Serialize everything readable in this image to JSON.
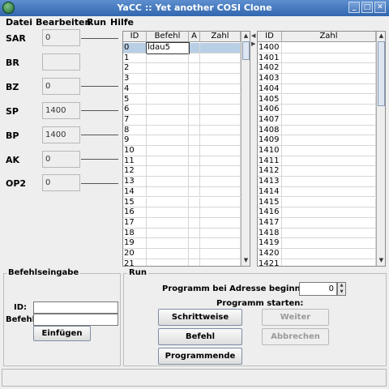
{
  "window": {
    "title": "YaCC :: Yet another COSI Clone",
    "buttons": [
      "_",
      "□",
      "✕"
    ],
    "icon": "globe-icon"
  },
  "menu": [
    "Datei",
    "Bearbeiten",
    "Run",
    "Hilfe"
  ],
  "registers": [
    {
      "label": "SAR",
      "value": "0"
    },
    {
      "label": "BR",
      "value": ""
    },
    {
      "label": "BZ",
      "value": "0"
    },
    {
      "label": "SP",
      "value": "1400"
    },
    {
      "label": "BP",
      "value": "1400"
    },
    {
      "label": "AK",
      "value": "0"
    },
    {
      "label": "OP2",
      "value": "0"
    }
  ],
  "program_table": {
    "headers": [
      "ID",
      "Befehl",
      "A",
      "Zahl"
    ],
    "rows": [
      [
        "0",
        "ldau5",
        "",
        ""
      ],
      [
        "1",
        "",
        "",
        ""
      ],
      [
        "2",
        "",
        "",
        ""
      ],
      [
        "3",
        "",
        "",
        ""
      ],
      [
        "4",
        "",
        "",
        ""
      ],
      [
        "5",
        "",
        "",
        ""
      ],
      [
        "6",
        "",
        "",
        ""
      ],
      [
        "7",
        "",
        "",
        ""
      ],
      [
        "8",
        "",
        "",
        ""
      ],
      [
        "9",
        "",
        "",
        ""
      ],
      [
        "10",
        "",
        "",
        ""
      ],
      [
        "11",
        "",
        "",
        ""
      ],
      [
        "12",
        "",
        "",
        ""
      ],
      [
        "13",
        "",
        "",
        ""
      ],
      [
        "14",
        "",
        "",
        ""
      ],
      [
        "15",
        "",
        "",
        ""
      ],
      [
        "16",
        "",
        "",
        ""
      ],
      [
        "17",
        "",
        "",
        ""
      ],
      [
        "18",
        "",
        "",
        ""
      ],
      [
        "19",
        "",
        "",
        ""
      ],
      [
        "20",
        "",
        "",
        ""
      ],
      [
        "21",
        "",
        "",
        ""
      ]
    ]
  },
  "memory_table": {
    "headers": [
      "ID",
      "Zahl"
    ],
    "rows": [
      [
        "1400",
        ""
      ],
      [
        "1401",
        ""
      ],
      [
        "1402",
        ""
      ],
      [
        "1403",
        ""
      ],
      [
        "1404",
        ""
      ],
      [
        "1405",
        ""
      ],
      [
        "1406",
        ""
      ],
      [
        "1407",
        ""
      ],
      [
        "1408",
        ""
      ],
      [
        "1409",
        ""
      ],
      [
        "1410",
        ""
      ],
      [
        "1411",
        ""
      ],
      [
        "1412",
        ""
      ],
      [
        "1413",
        ""
      ],
      [
        "1414",
        ""
      ],
      [
        "1415",
        ""
      ],
      [
        "1416",
        ""
      ],
      [
        "1417",
        ""
      ],
      [
        "1418",
        ""
      ],
      [
        "1419",
        ""
      ],
      [
        "1420",
        ""
      ],
      [
        "1421",
        ""
      ]
    ]
  },
  "befehlseingabe": {
    "title": "Befehlseingabe",
    "id_label": "ID:",
    "befehl_label": "Befehl:",
    "insert_button": "Einfügen"
  },
  "run": {
    "title": "Run",
    "start_address_label": "Programm bei Adresse beginnen:",
    "start_address_value": "0",
    "start_label": "Programm starten:",
    "step_button": "Schrittweise",
    "continue_button": "Weiter",
    "command_button": "Befehl",
    "abort_button": "Abbrechen",
    "end_button": "Programmende"
  },
  "colors": {
    "titlebar": "#3f72b8",
    "selection": "#b8cfe5"
  }
}
